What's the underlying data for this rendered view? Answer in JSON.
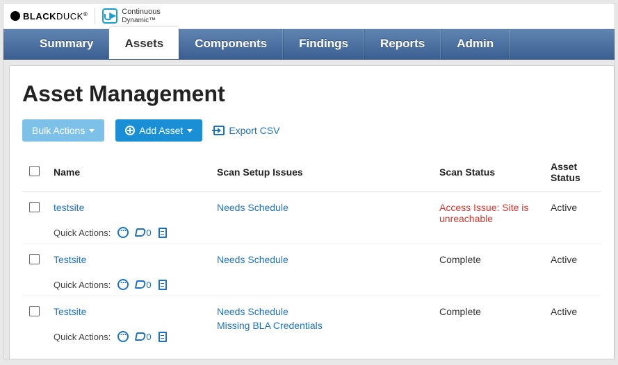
{
  "brand": {
    "black": "BLACK",
    "duck": "DUCK",
    "reg": "®",
    "cd_line1": "Continuous",
    "cd_line2": "Dynamic™"
  },
  "nav": {
    "tabs": [
      {
        "label": "Summary",
        "active": false
      },
      {
        "label": "Assets",
        "active": true
      },
      {
        "label": "Components",
        "active": false
      },
      {
        "label": "Findings",
        "active": false
      },
      {
        "label": "Reports",
        "active": false
      },
      {
        "label": "Admin",
        "active": false
      }
    ]
  },
  "page": {
    "title": "Asset Management"
  },
  "toolbar": {
    "bulk_label": "Bulk Actions",
    "add_label": "Add Asset",
    "export_label": "Export CSV"
  },
  "table": {
    "headers": {
      "name": "Name",
      "issues": "Scan Setup Issues",
      "scan_status": "Scan Status",
      "asset_status": "Asset Status"
    },
    "quick_label": "Quick Actions:",
    "rows": [
      {
        "name": "testsite",
        "issues": [
          "Needs Schedule"
        ],
        "scan_status": "Access Issue: Site is unreachable",
        "scan_error": true,
        "asset_status": "Active",
        "tag_count": "0"
      },
      {
        "name": "Testsite",
        "issues": [
          "Needs Schedule"
        ],
        "scan_status": "Complete",
        "scan_error": false,
        "asset_status": "Active",
        "tag_count": "0"
      },
      {
        "name": "Testsite",
        "issues": [
          "Needs Schedule",
          "Missing BLA Credentials"
        ],
        "scan_status": "Complete",
        "scan_error": false,
        "asset_status": "Active",
        "tag_count": "0"
      }
    ]
  }
}
